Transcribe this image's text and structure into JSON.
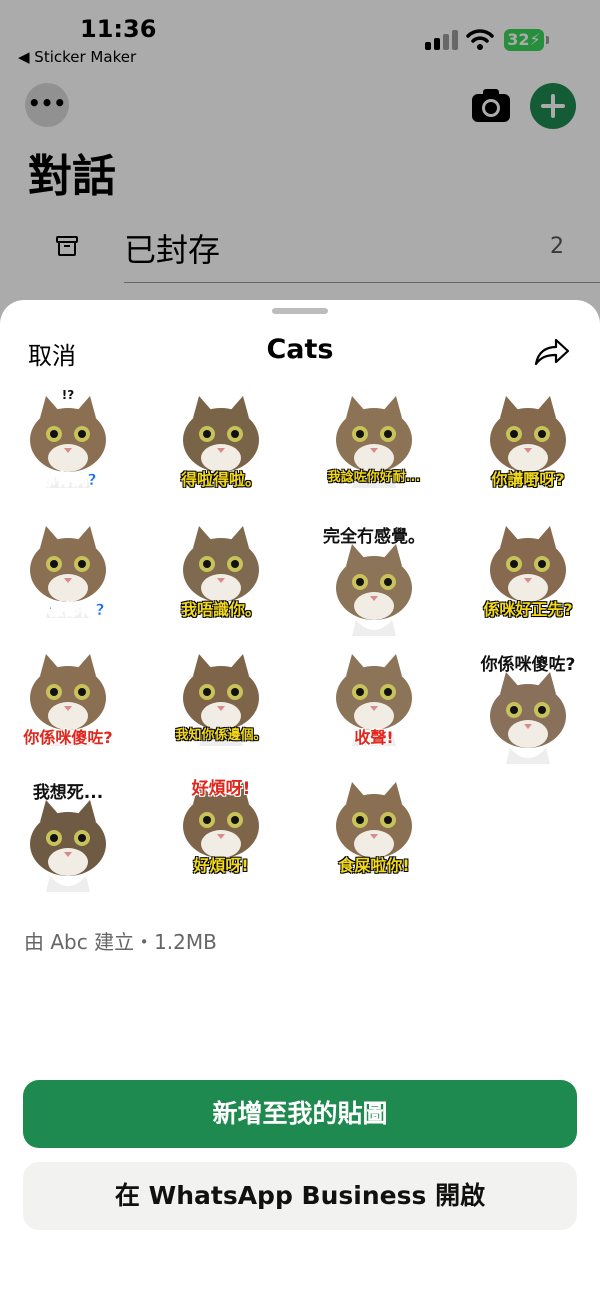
{
  "status_bar": {
    "time": "11:36",
    "back_app": "◀ Sticker Maker",
    "battery": "32"
  },
  "header": {
    "more_glyph": "•••",
    "title": "對話"
  },
  "archive": {
    "label": "已封存",
    "count": "2"
  },
  "sheet": {
    "cancel_label": "取消",
    "title": "Cats",
    "stickers": [
      {
        "caption": "你有病?",
        "top_text": "!?"
      },
      {
        "caption": "得啦得啦。"
      },
      {
        "caption": "我諗咗你好耐..."
      },
      {
        "caption": "你講嘢呀?"
      },
      {
        "caption": "咁樣都得?"
      },
      {
        "caption": "我唔識你。"
      },
      {
        "caption": "完全冇感覺。"
      },
      {
        "caption": "係咪好正先?"
      },
      {
        "caption": "你係咪傻咗?"
      },
      {
        "caption": "我知你係邊個。"
      },
      {
        "caption": "收聲!"
      },
      {
        "caption": "你係咪傻咗?"
      },
      {
        "caption": "我想死..."
      },
      {
        "caption": "好煩呀!",
        "top_text": "好煩呀!"
      },
      {
        "caption": "食屎啦你!"
      }
    ],
    "meta": "由 Abc 建立・1.2MB",
    "primary_button": "新增至我的貼圖",
    "secondary_button": "在 WhatsApp Business 開啟"
  },
  "colors": {
    "accent": "#1f8a50",
    "battery": "#3bd45c"
  },
  "icons": [
    "more-icon",
    "camera-icon",
    "plus-icon",
    "archive-icon",
    "share-icon"
  ]
}
